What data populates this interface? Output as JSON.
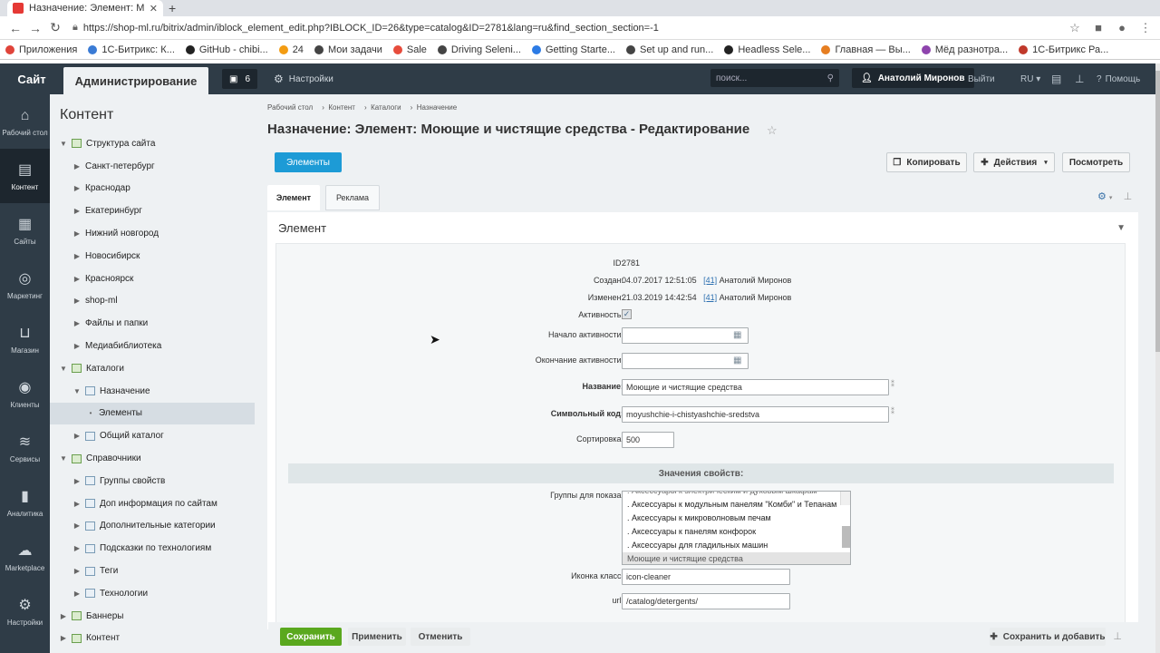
{
  "browser": {
    "tab_title": "Назначение: Элемент: М",
    "url": "https://shop-ml.ru/bitrix/admin/iblock_element_edit.php?IBLOCK_ID=26&type=catalog&ID=2781&lang=ru&find_section_section=-1",
    "bookmarks": [
      "Приложения",
      "1С-Битрикс: К...",
      "GitHub - chibi...",
      "24",
      "Мои задачи",
      "Sale",
      "Driving Seleni...",
      "Getting Starte...",
      "Set up and run...",
      "Headless Sele...",
      "Главная — Вы...",
      "Мёд разнотра...",
      "1С-Битрикс Ра..."
    ]
  },
  "topbar": {
    "site": "Сайт",
    "admin": "Администрирование",
    "notif_count": "6",
    "settings": "Настройки",
    "search_placeholder": "поиск...",
    "user": "Анатолий Миронов",
    "logout": "Выйти",
    "lang": "RU",
    "help": "Помощь"
  },
  "leftnav": [
    {
      "label": "Рабочий стол",
      "icon": "home-icon"
    },
    {
      "label": "Контент",
      "icon": "document-icon"
    },
    {
      "label": "Сайты",
      "icon": "calendar-24-icon"
    },
    {
      "label": "Маркетинг",
      "icon": "target-icon"
    },
    {
      "label": "Магазин",
      "icon": "basket-icon"
    },
    {
      "label": "Клиенты",
      "icon": "clients-24-icon"
    },
    {
      "label": "Сервисы",
      "icon": "layers-icon"
    },
    {
      "label": "Аналитика",
      "icon": "bar-chart-icon"
    },
    {
      "label": "Marketplace",
      "icon": "cloud-icon"
    },
    {
      "label": "Настройки",
      "icon": "gear-icon"
    }
  ],
  "tree": {
    "title": "Контент",
    "items": [
      {
        "label": "Структура сайта"
      },
      {
        "label": "Санкт-петербург"
      },
      {
        "label": "Краснодар"
      },
      {
        "label": "Екатеринбург"
      },
      {
        "label": "Нижний новгород"
      },
      {
        "label": "Новосибирск"
      },
      {
        "label": "Красноярск"
      },
      {
        "label": "shop-ml"
      },
      {
        "label": "Файлы и папки"
      },
      {
        "label": "Медиабиблиотека"
      },
      {
        "label": "Каталоги"
      },
      {
        "label": "Назначение"
      },
      {
        "label": "Элементы"
      },
      {
        "label": "Общий каталог"
      },
      {
        "label": "Справочники"
      },
      {
        "label": "Группы свойств"
      },
      {
        "label": "Доп информация по сайтам"
      },
      {
        "label": "Дополнительные категории"
      },
      {
        "label": "Подсказки по технологиям"
      },
      {
        "label": "Теги"
      },
      {
        "label": "Технологии"
      },
      {
        "label": "Баннеры"
      },
      {
        "label": "Контент"
      }
    ]
  },
  "main": {
    "breadcrumb": [
      "Рабочий стол",
      "Контент",
      "Каталоги",
      "Назначение"
    ],
    "title": "Назначение: Элемент: Моющие и чистящие средства - Редактирование",
    "elements_btn": "Элементы",
    "copy_btn": "Копировать",
    "actions_btn": "Действия",
    "view_btn": "Посмотреть",
    "tab_element": "Элемент",
    "tab_ads": "Реклама",
    "panel_title": "Элемент"
  },
  "form": {
    "id_label": "ID:",
    "id_value": "2781",
    "created_label": "Создан:",
    "created_value": "04.07.2017 12:51:05",
    "created_user_id": "[41]",
    "created_user": "Анатолий Миронов",
    "changed_label": "Изменен:",
    "changed_value": "21.03.2019 14:42:54",
    "changed_user_id": "[41]",
    "changed_user": "Анатолий Миронов",
    "active_label": "Активность:",
    "active_from_label": "Начало активности:",
    "active_to_label": "Окончание активности:",
    "name_label": "Название:",
    "name_value": "Моющие и чистящие средства",
    "code_label": "Символьный код:",
    "code_value": "moyushchie-i-chistyashchie-sredstva",
    "sort_label": "Сортировка:",
    "sort_value": "500",
    "section_title": "Значения свойств:",
    "groups_label": "Группы для показа:",
    "groups_options": [
      ". Аксессуары к электрическим и духовым шкафам",
      ". Аксессуары к модульным панелям \"Комби\" и Тепанам",
      ". Аксессуары к микроволновым печам",
      ". Аксессуары к панелям конфорок",
      ". Аксессуары для гладильных машин",
      "Моющие и чистящие средства"
    ],
    "icon_label": "Иконка класс:",
    "icon_value": "icon-cleaner",
    "url_label": "url:",
    "url_value": "/catalog/detergents/"
  },
  "footer": {
    "save": "Сохранить",
    "apply": "Применить",
    "cancel": "Отменить",
    "save_add": "Сохранить и добавить"
  }
}
